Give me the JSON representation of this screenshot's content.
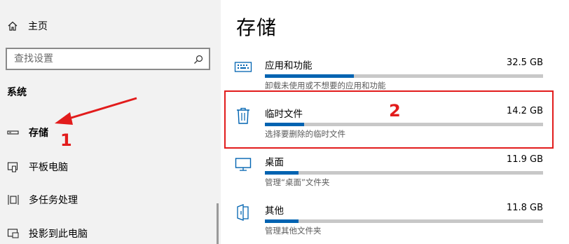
{
  "sidebar": {
    "home_label": "主页",
    "search_placeholder": "查找设置",
    "section_title": "系统",
    "items": [
      {
        "label": "存储",
        "icon": "storage-icon",
        "active": true
      },
      {
        "label": "平板电脑",
        "icon": "tablet-icon",
        "active": false
      },
      {
        "label": "多任务处理",
        "icon": "multitask-icon",
        "active": false
      },
      {
        "label": "投影到此电脑",
        "icon": "project-icon",
        "active": false
      }
    ]
  },
  "main": {
    "title": "存储",
    "items": [
      {
        "name": "应用和功能",
        "size": "32.5 GB",
        "fraction": 0.32,
        "desc": "卸载未使用或不想要的应用和功能",
        "icon": "apps-keyboard-icon"
      },
      {
        "name": "临时文件",
        "size": "14.2 GB",
        "fraction": 0.14,
        "desc": "选择要删除的临时文件",
        "icon": "trash-icon"
      },
      {
        "name": "桌面",
        "size": "11.9 GB",
        "fraction": 0.12,
        "desc": "管理“桌面”文件夹",
        "icon": "desktop-icon"
      },
      {
        "name": "其他",
        "size": "11.8 GB",
        "fraction": 0.12,
        "desc": "管理其他文件夹",
        "icon": "folder-icon"
      }
    ]
  },
  "annotations": {
    "label_1": "1",
    "label_2": "2",
    "color": "#e21c1c"
  },
  "colors": {
    "accent": "#0063b1",
    "sidebar_bg": "#f2f2f2"
  }
}
